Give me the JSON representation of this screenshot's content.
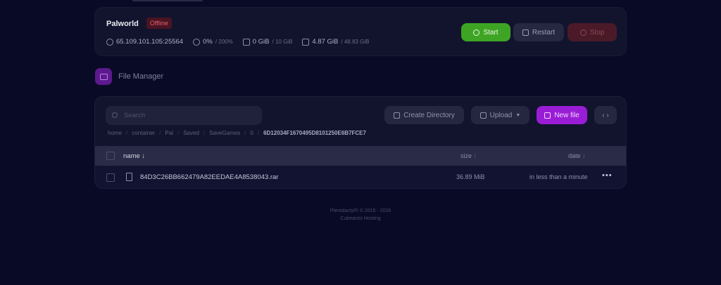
{
  "server": {
    "name": "Palworld",
    "status": "Offline",
    "address": "65.109.101.105:25564",
    "cpu": "0%",
    "cpu_limit": "/ 200%",
    "memory": "0 GiB",
    "memory_limit": "/ 10 GiB",
    "disk": "4.87 GiB",
    "disk_limit": "/ 48.83 GiB",
    "buttons": {
      "start": "Start",
      "restart": "Restart",
      "stop": "Stop"
    },
    "colors": {
      "start": "#3ea524",
      "stop": "#4b1a28",
      "offline": "#e06070"
    }
  },
  "file_manager": {
    "title": "File Manager",
    "search_placeholder": "Search",
    "actions": {
      "create_directory": "Create Directory",
      "upload": "Upload",
      "new_file": "New file"
    },
    "breadcrumb": [
      "home",
      "container",
      "Pal",
      "Saved",
      "SaveGames",
      "0",
      "6D12034F1670495D8101250E6B7FCE7"
    ],
    "columns": {
      "name": "name",
      "size": "size",
      "date": "date"
    },
    "sort_indicator": "↓",
    "files": [
      {
        "name": "84D3C26BB662479A82EEDAE4A8538043.rar",
        "size": "36.89 MiB",
        "date": "in less than a minute",
        "icon": "file-icon"
      }
    ]
  },
  "footer": {
    "line1": "Pterodactyl® © 2015 - 2026",
    "line2": "Cubeaces Hosting"
  }
}
